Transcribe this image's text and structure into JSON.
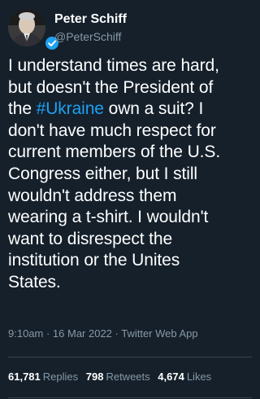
{
  "author": {
    "display_name": "Peter Schiff",
    "handle": "@PeterSchiff",
    "verified": true,
    "verified_badge_color": "#1da1f2"
  },
  "tweet": {
    "lines": {
      "l1": "I understand times are hard,",
      "l2": "but doesn't the President of",
      "l3_pre": "the ",
      "l3_hashtag": "#Ukraine",
      "l3_post": " own a suit? I",
      "l4": "don't have much respect for",
      "l5": "current members of the U.S.",
      "l6": "Congress either, but I still",
      "l7": "wouldn't address them",
      "l8": "wearing a t-shirt. I wouldn't",
      "l9": "want to disrespect the",
      "l10": "institution or the Unites",
      "l11": "States."
    },
    "hashtag_color": "#1da1f2"
  },
  "meta": {
    "time_date_source": "9:10am · 16 Mar 2022 · Twitter Web App"
  },
  "stats": {
    "replies_count": "61,781",
    "replies_label": "Replies",
    "retweets_count": "798",
    "retweets_label": "Retweets",
    "likes_count": "4,674",
    "likes_label": "Likes"
  },
  "theme": {
    "background": "#15202b",
    "text": "#ffffff",
    "secondary_text": "#8899a6",
    "divider": "#38444d"
  }
}
